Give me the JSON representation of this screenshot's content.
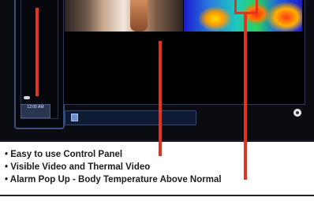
{
  "control_panel": {
    "clock_text": "12:00 AM"
  },
  "colors": {
    "pointer": "#e2331d",
    "panel_border": "#3a4e78",
    "screen_background": "#0a0c12",
    "caption_text": "#1c1c1c"
  },
  "icons": {
    "bottom_bar": "video-icon",
    "corner": "settings-icon"
  },
  "captions": [
    "Easy to use Control Panel",
    "Visible Video and Thermal Video",
    "Alarm Pop Up - Body Temperature Above Normal"
  ]
}
